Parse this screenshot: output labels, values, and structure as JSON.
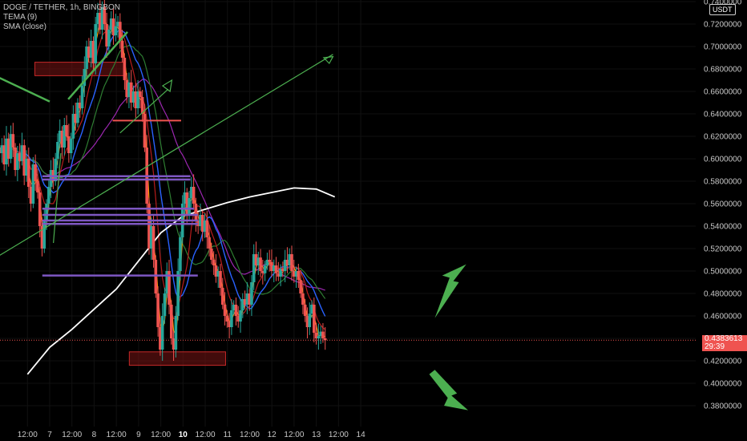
{
  "legend": {
    "symbol": "DOGE / TETHER, 1h, BINGBON",
    "tema": "TEMA (9)",
    "sma": "SMA (close)"
  },
  "currency_label": "USDT",
  "last_price": {
    "value": "0.4383613",
    "countdown": "29:39"
  },
  "colors": {
    "background": "#000000",
    "up": "#26a69a",
    "down": "#ef5350",
    "tema": "#ff9800",
    "sma_long": "#ffffff",
    "ma_blue": "#2962ff",
    "ma_red": "#b71c1c",
    "ma_green": "#2e7d32",
    "ma_purple": "#9c27b0",
    "levels": "#7e57c2",
    "zones": "#c62828",
    "arrows": "#4caf50"
  },
  "chart_data": {
    "type": "candlestick",
    "title": "DOGE / TETHER, 1h, BINGBON",
    "y_axis": {
      "range": [
        0.37,
        0.74
      ],
      "ticks": [
        "0.7400000",
        "0.7200000",
        "0.7000000",
        "0.6800000",
        "0.6600000",
        "0.6400000",
        "0.6200000",
        "0.6000000",
        "0.5800000",
        "0.5600000",
        "0.5400000",
        "0.5200000",
        "0.5000000",
        "0.4800000",
        "0.4600000",
        "0.4400000",
        "0.4200000",
        "0.4000000",
        "0.3800000"
      ],
      "tick_values": [
        0.74,
        0.72,
        0.7,
        0.68,
        0.66,
        0.64,
        0.62,
        0.6,
        0.58,
        0.56,
        0.54,
        0.52,
        0.5,
        0.48,
        0.46,
        0.44,
        0.42,
        0.4,
        0.38
      ]
    },
    "x_axis": {
      "ticks": [
        {
          "label": "12:00",
          "hour": -12
        },
        {
          "label": "7",
          "hour": 0
        },
        {
          "label": "12:00",
          "hour": 12
        },
        {
          "label": "8",
          "hour": 24
        },
        {
          "label": "12:00",
          "hour": 36
        },
        {
          "label": "9",
          "hour": 48
        },
        {
          "label": "12:00",
          "hour": 60
        },
        {
          "label": "10",
          "hour": 72,
          "bold": true
        },
        {
          "label": "12:00",
          "hour": 84
        },
        {
          "label": "11",
          "hour": 96
        },
        {
          "label": "12:00",
          "hour": 108
        },
        {
          "label": "12",
          "hour": 120
        },
        {
          "label": "12:00",
          "hour": 132
        },
        {
          "label": "13",
          "hour": 144
        },
        {
          "label": "12:00",
          "hour": 156
        },
        {
          "label": "14",
          "hour": 168
        }
      ]
    },
    "candles_close": [
      0.605,
      0.612,
      0.595,
      0.618,
      0.6,
      0.622,
      0.61,
      0.59,
      0.605,
      0.598,
      0.612,
      0.585,
      0.6,
      0.575,
      0.56,
      0.595,
      0.58,
      0.57,
      0.54,
      0.52,
      0.545,
      0.56,
      0.575,
      0.59,
      0.58,
      0.6,
      0.615,
      0.625,
      0.61,
      0.63,
      0.62,
      0.605,
      0.618,
      0.64,
      0.632,
      0.65,
      0.645,
      0.665,
      0.68,
      0.7,
      0.69,
      0.705,
      0.685,
      0.72,
      0.73,
      0.715,
      0.735,
      0.72,
      0.7,
      0.715,
      0.725,
      0.71,
      0.718,
      0.722,
      0.705,
      0.69,
      0.67,
      0.655,
      0.668,
      0.65,
      0.66,
      0.645,
      0.66,
      0.655,
      0.64,
      0.61,
      0.56,
      0.52,
      0.54,
      0.51,
      0.48,
      0.45,
      0.43,
      0.46,
      0.48,
      0.5,
      0.47,
      0.44,
      0.43,
      0.46,
      0.5,
      0.53,
      0.56,
      0.57,
      0.55,
      0.565,
      0.575,
      0.56,
      0.545,
      0.54,
      0.55,
      0.535,
      0.545,
      0.53,
      0.52,
      0.51,
      0.505,
      0.495,
      0.5,
      0.485,
      0.47,
      0.46,
      0.455,
      0.45,
      0.465,
      0.47,
      0.46,
      0.455,
      0.465,
      0.475,
      0.47,
      0.48,
      0.47,
      0.49,
      0.515,
      0.505,
      0.512,
      0.5,
      0.498,
      0.505,
      0.51,
      0.508,
      0.5,
      0.505,
      0.498,
      0.495,
      0.502,
      0.5,
      0.51,
      0.505,
      0.515,
      0.5,
      0.495,
      0.5,
      0.492,
      0.48,
      0.47,
      0.46,
      0.45,
      0.462,
      0.47,
      0.445,
      0.44,
      0.442,
      0.446,
      0.44,
      0.4383613
    ],
    "levels": [
      {
        "price": 0.5845,
        "x0_hour": -4,
        "x1_hour": 76
      },
      {
        "price": 0.5815,
        "x0_hour": -4,
        "x1_hour": 76
      },
      {
        "price": 0.5555,
        "x0_hour": -4,
        "x1_hour": 78
      },
      {
        "price": 0.55,
        "x0_hour": -4,
        "x1_hour": 80
      },
      {
        "price": 0.545,
        "x0_hour": -4,
        "x1_hour": 80
      },
      {
        "price": 0.542,
        "x0_hour": -4,
        "x1_hour": 80
      },
      {
        "price": 0.496,
        "x0_hour": -4,
        "x1_hour": 80
      }
    ],
    "zones": [
      {
        "top": 0.686,
        "bottom": 0.674,
        "x0_hour": -8,
        "x1_hour": 40
      },
      {
        "top": 0.428,
        "bottom": 0.416,
        "x0_hour": 43,
        "x1_hour": 95
      }
    ],
    "sma_line": [
      [
        -12,
        0.408
      ],
      [
        0,
        0.432
      ],
      [
        12,
        0.448
      ],
      [
        24,
        0.466
      ],
      [
        36,
        0.484
      ],
      [
        48,
        0.509
      ],
      [
        60,
        0.534
      ],
      [
        72,
        0.549
      ],
      [
        84,
        0.555
      ],
      [
        96,
        0.561
      ],
      [
        108,
        0.566
      ],
      [
        120,
        0.57
      ],
      [
        132,
        0.574
      ],
      [
        144,
        0.573
      ],
      [
        154,
        0.566
      ]
    ],
    "last_price": 0.4383613
  }
}
